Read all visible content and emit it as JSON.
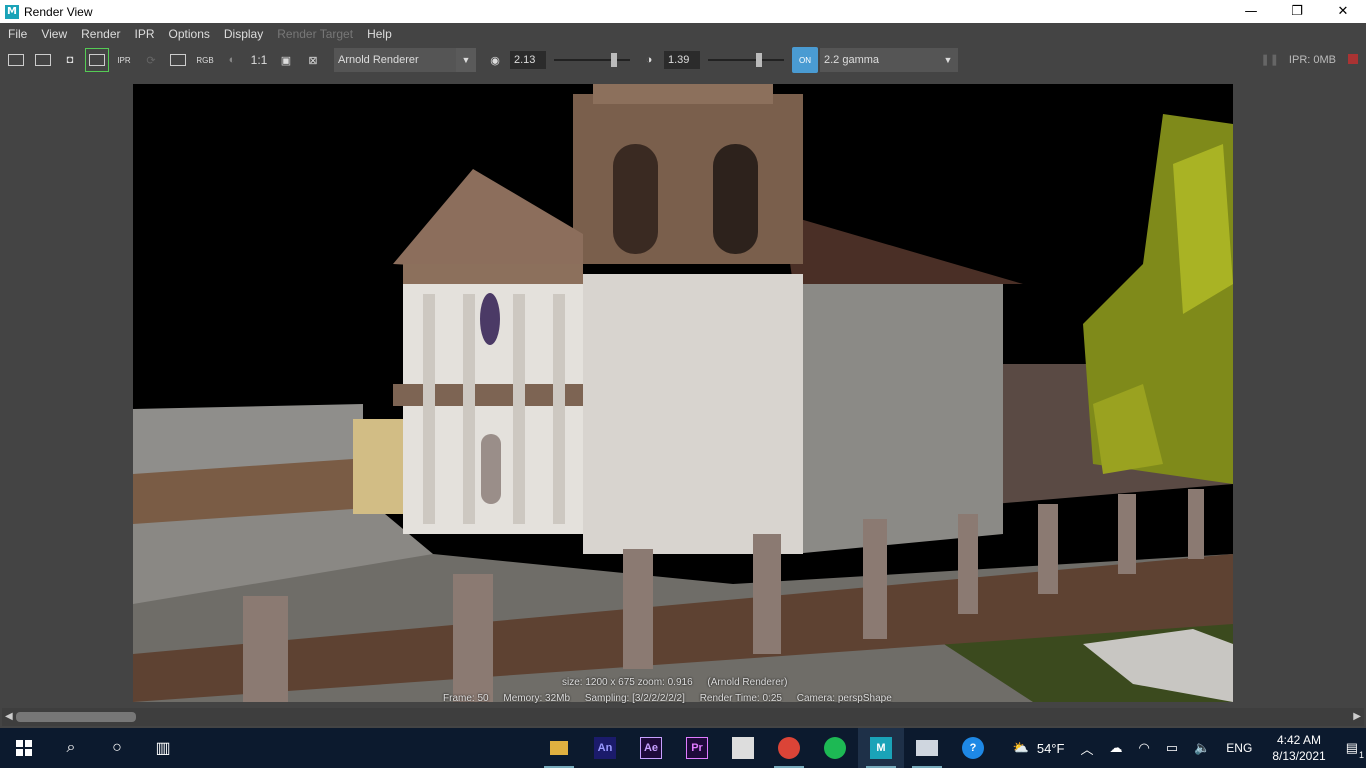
{
  "window": {
    "title": "Render View",
    "app_icon": "M",
    "minimize": "—",
    "restore": "❐",
    "close": "✕"
  },
  "menu": [
    "File",
    "View",
    "Render",
    "IPR",
    "Options",
    "Display",
    "Render Target",
    "Help"
  ],
  "toolbar": {
    "rgb_label": "RGB",
    "ratio_label": "1:1",
    "ipr_label": "IPR",
    "renderer": "Arnold Renderer",
    "exposure": "2.13",
    "gamma_value": "1.39",
    "gamma_toggle": "ON",
    "color_space": "2.2 gamma",
    "ipr_memory": "IPR: 0MB",
    "exposure_level": 0.82,
    "gamma_level": 0.68
  },
  "render_info": {
    "size_line": "size: 1200 x 675  zoom: 0.916",
    "renderer_tag": "(Arnold Renderer)",
    "frame": "Frame: 50",
    "memory": "Memory: 32Mb",
    "sampling": "Sampling: [3/2/2/2/2/2]",
    "render_time": "Render Time: 0:25",
    "camera": "Camera: perspShape"
  },
  "taskbar": {
    "apps": [
      {
        "name": "file-explorer",
        "label": ""
      },
      {
        "name": "animate",
        "label": "An",
        "color": "#1b1b6b",
        "fg": "#99f"
      },
      {
        "name": "after-effects",
        "label": "Ae",
        "color": "#1f0a3a",
        "fg": "#c8a0ff"
      },
      {
        "name": "premiere",
        "label": "Pr",
        "color": "#1f0a3a",
        "fg": "#e07bff"
      },
      {
        "name": "anime-app",
        "label": ""
      },
      {
        "name": "chrome",
        "label": ""
      },
      {
        "name": "spotify",
        "label": ""
      },
      {
        "name": "maya",
        "label": "M"
      },
      {
        "name": "screen-app",
        "label": ""
      },
      {
        "name": "help",
        "label": "?"
      }
    ],
    "weather": "54°F",
    "language": "ENG",
    "time": "4:42 AM",
    "date": "8/13/2021",
    "notifications": "1"
  }
}
